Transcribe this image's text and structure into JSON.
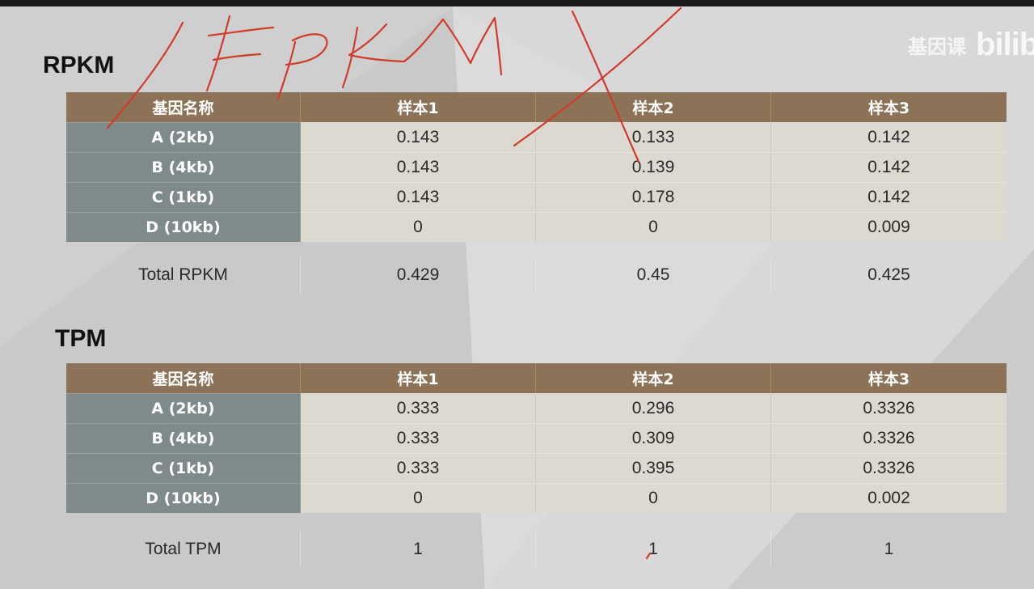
{
  "watermark": {
    "text": "基因课",
    "logo": "bilibili"
  },
  "rpkm": {
    "title": "RPKM",
    "headers": [
      "基因名称",
      "样本1",
      "样本2",
      "样本3"
    ],
    "rows": [
      {
        "name": "A (2kb)",
        "values": [
          "0.143",
          "0.133",
          "0.142"
        ]
      },
      {
        "name": "B (4kb)",
        "values": [
          "0.143",
          "0.139",
          "0.142"
        ]
      },
      {
        "name": "C (1kb)",
        "values": [
          "0.143",
          "0.178",
          "0.142"
        ]
      },
      {
        "name": "D (10kb)",
        "values": [
          "0",
          "0",
          "0.009"
        ]
      }
    ],
    "total": {
      "label": "Total RPKM",
      "values": [
        "0.429",
        "0.45",
        "0.425"
      ]
    }
  },
  "tpm": {
    "title": "TPM",
    "headers": [
      "基因名称",
      "样本1",
      "样本2",
      "样本3"
    ],
    "rows": [
      {
        "name": "A (2kb)",
        "values": [
          "0.333",
          "0.296",
          "0.3326"
        ]
      },
      {
        "name": "B (4kb)",
        "values": [
          "0.333",
          "0.309",
          "0.3326"
        ]
      },
      {
        "name": "C (1kb)",
        "values": [
          "0.333",
          "0.395",
          "0.3326"
        ]
      },
      {
        "name": "D (10kb)",
        "values": [
          "0",
          "0",
          "0.002"
        ]
      }
    ],
    "total": {
      "label": "Total TPM",
      "values": [
        "1",
        "1",
        "1"
      ]
    }
  },
  "annotation": {
    "text": "/FPKM",
    "color": "#d23a2a"
  }
}
